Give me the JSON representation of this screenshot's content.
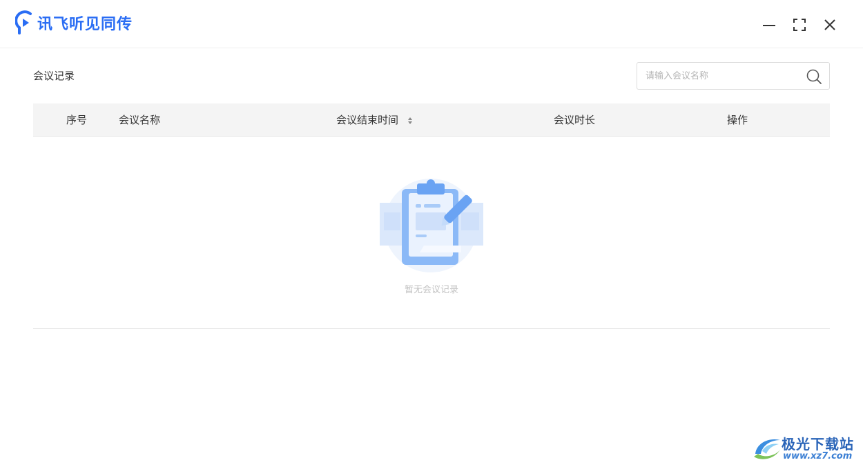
{
  "app": {
    "title": "讯飞听见同传"
  },
  "window_controls": {
    "minimize_icon": "minimize-icon",
    "maximize_icon": "maximize-icon",
    "close_icon": "close-icon"
  },
  "page": {
    "section_title": "会议记录"
  },
  "search": {
    "placeholder": "请输入会议名称",
    "value": "",
    "icon": "search-icon"
  },
  "table": {
    "columns": [
      {
        "label": "序号"
      },
      {
        "label": "会议名称"
      },
      {
        "label": "会议结束时间",
        "sortable": true
      },
      {
        "label": "会议时长"
      },
      {
        "label": "操作"
      }
    ],
    "rows": [],
    "empty_text": "暂无会议记录",
    "empty_icon": "clipboard-pen-illustration"
  },
  "watermark": {
    "name": "极光下载站",
    "url": "www.xz7.com"
  },
  "colors": {
    "brand": "#2a6df4",
    "header_bg": "#f4f4f4",
    "empty_text": "#c2c2c2"
  }
}
